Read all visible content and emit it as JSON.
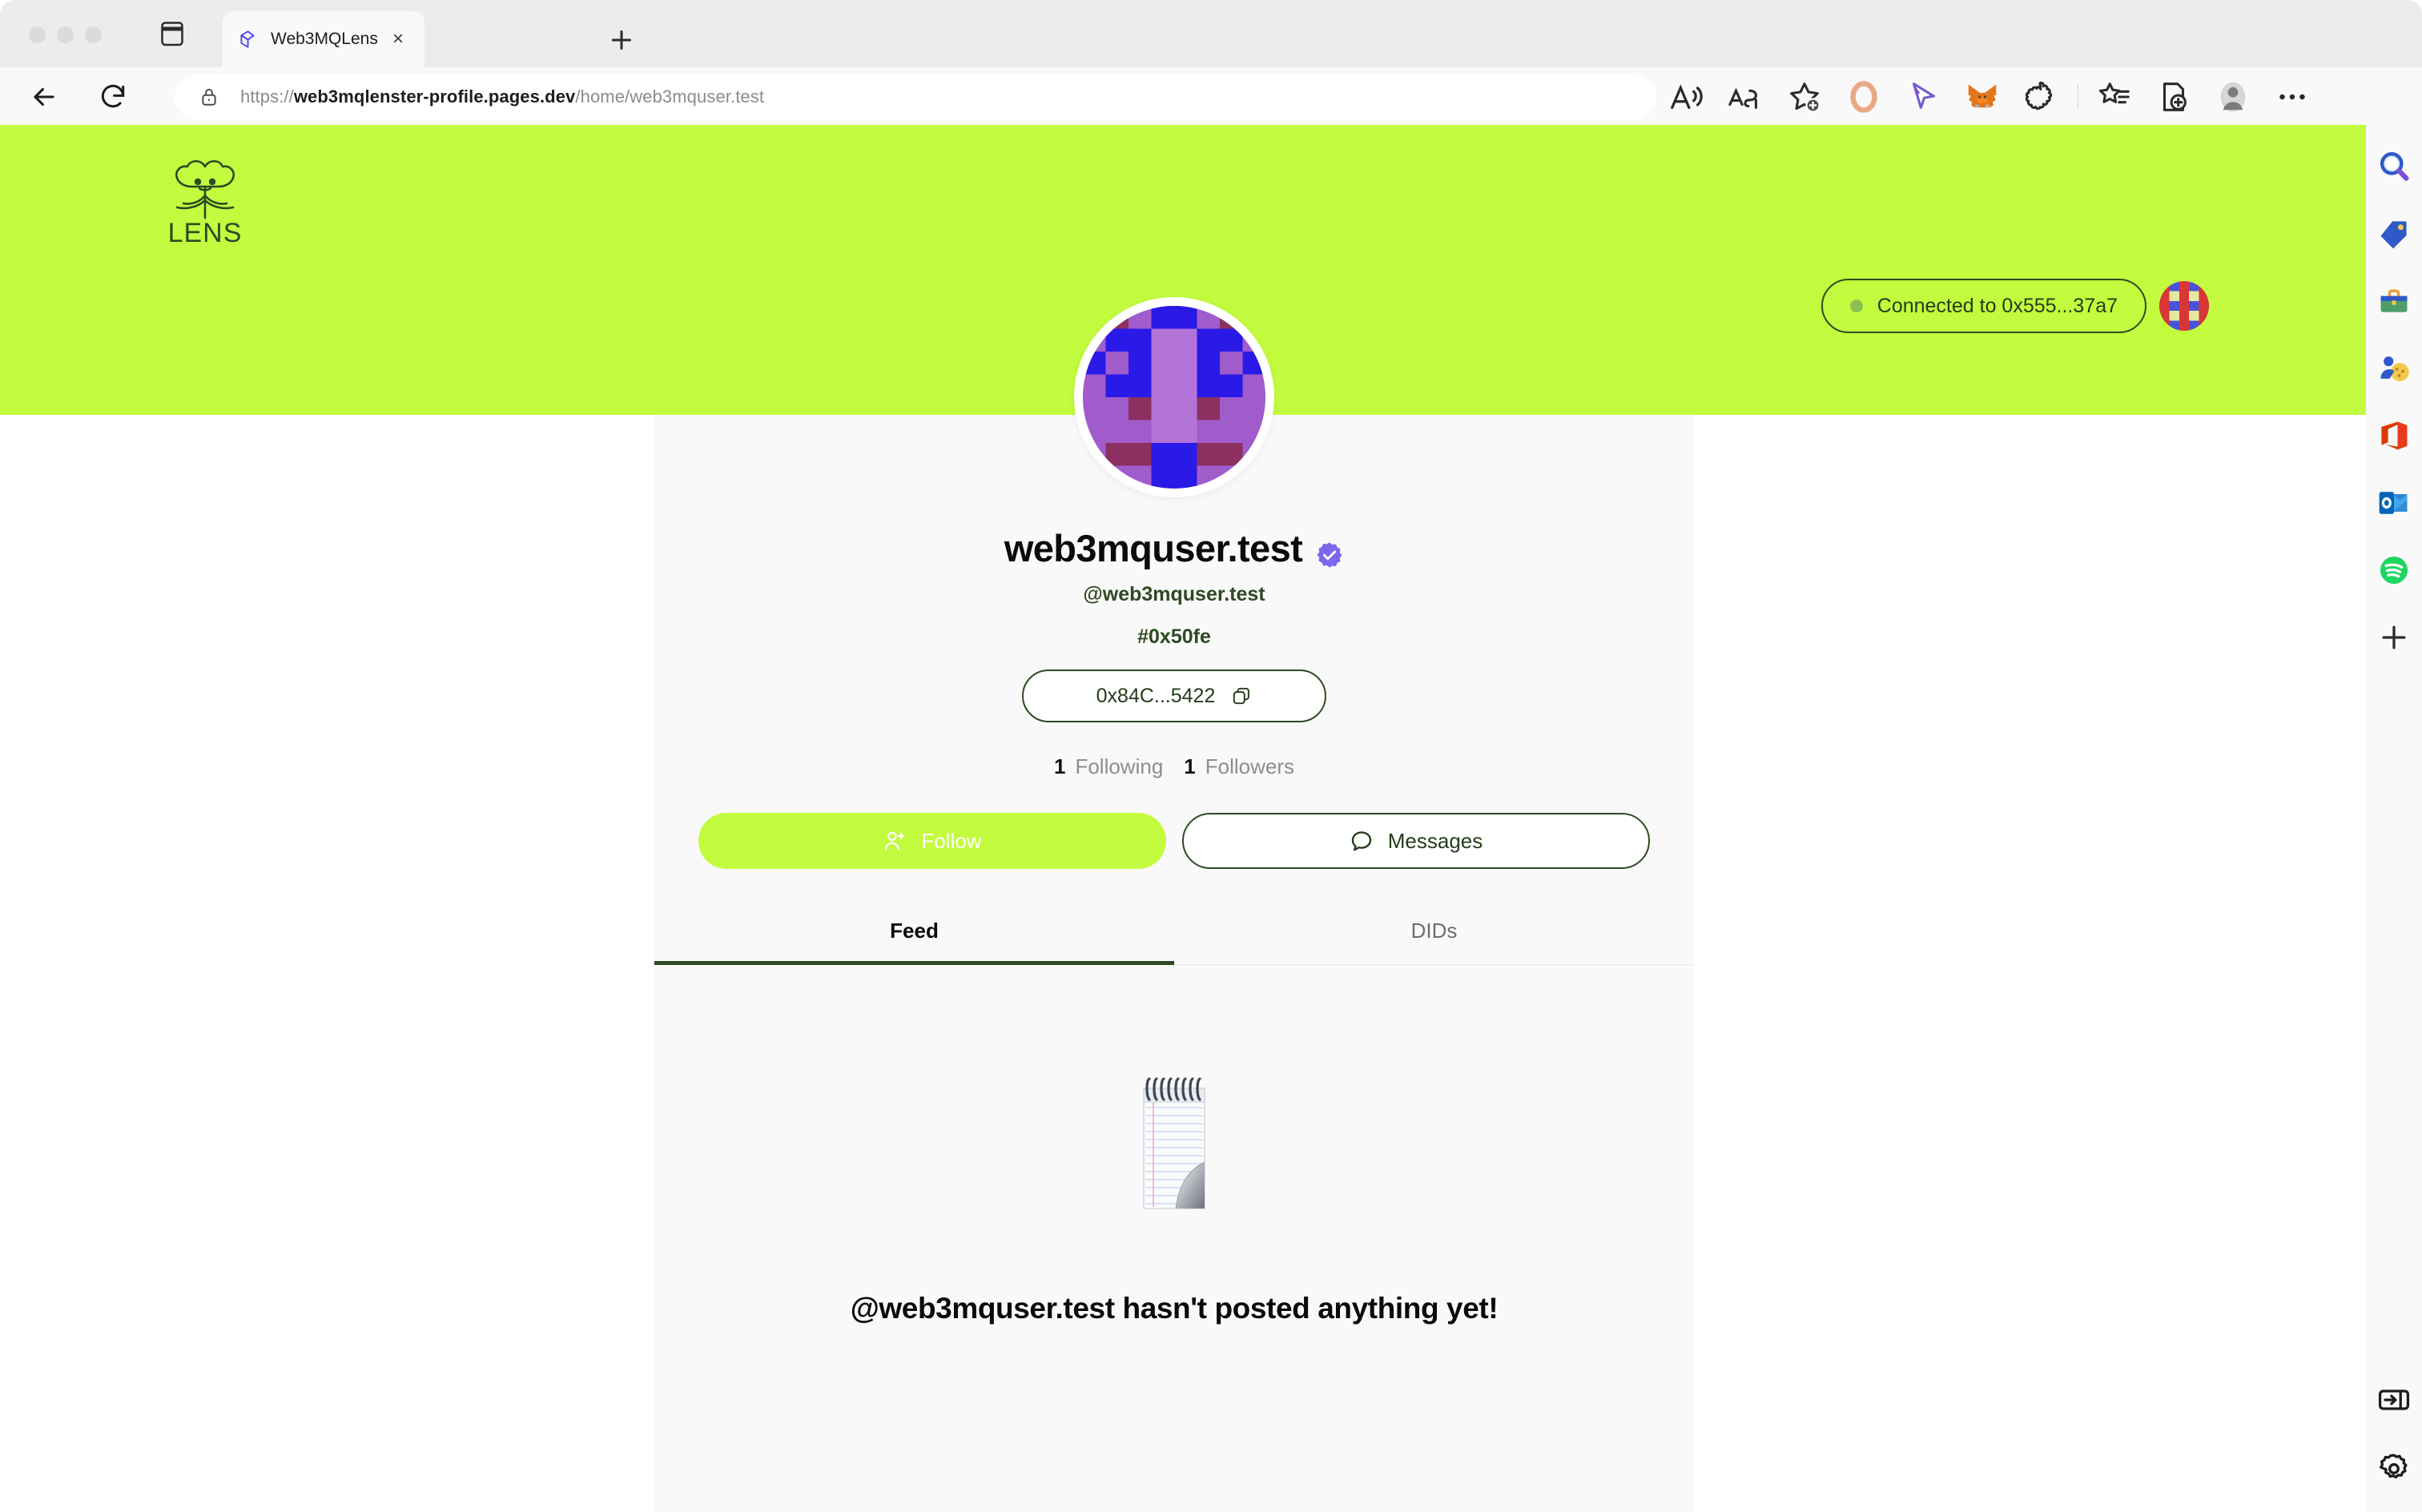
{
  "browser": {
    "tab": {
      "title": "Web3MQLens",
      "favicon_name": "web3mq-cube-icon",
      "close_label": "×"
    },
    "new_tab_label": "+",
    "address": {
      "protocol": "https://",
      "domain": "web3mqlenster-profile.pages.dev",
      "path": "/home/web3mquser.test",
      "full_url": "https://web3mqlenster-profile.pages.dev/home/web3mquser.test",
      "security_icon": "lock-icon"
    },
    "toolbar_icons": [
      "read-aloud-icon",
      "translate-icon",
      "add-favorite-icon",
      "orange-ring-extension-icon",
      "cursor-extension-icon",
      "metamask-fox-icon",
      "puzzle-blob-extension-icon",
      "collections-icon",
      "split-screen-icon",
      "profile-avatar-icon",
      "more-options-icon"
    ],
    "sidebar_icons": [
      "search-icon",
      "shopping-tag-icon",
      "tools-icon",
      "games-icon",
      "office-icon",
      "outlook-icon",
      "spotify-icon",
      "add-sidebar-app-icon"
    ],
    "sidebar_bottom_icons": [
      "expand-sidebar-icon",
      "settings-gear-icon"
    ]
  },
  "page": {
    "banner_color": "#c3fb3e",
    "logo_name": "lens-logo",
    "logo_text": "LENS",
    "wallet": {
      "status_label": "Connected to 0x555...37a7",
      "status_dot_color": "#8cc152",
      "avatar_name": "wallet-identicon"
    },
    "profile": {
      "avatar_name": "profile-identicon",
      "display_name": "web3mquser.test",
      "verified_badge": "verified-check-icon",
      "handle": "@web3mquser.test",
      "profile_id": "#0x50fe",
      "wallet_address": "0x84C...5422",
      "copy_icon": "copy-icon",
      "stats": [
        {
          "count": "1",
          "label": "Following"
        },
        {
          "count": "1",
          "label": "Followers"
        }
      ],
      "follow_button": "Follow",
      "messages_button": "Messages"
    },
    "tabs": [
      {
        "label": "Feed",
        "active": true
      },
      {
        "label": "DIDs",
        "active": false
      }
    ],
    "empty_state": {
      "icon": "notepad-emoji",
      "message": "@web3mquser.test hasn't posted anything yet!"
    }
  }
}
